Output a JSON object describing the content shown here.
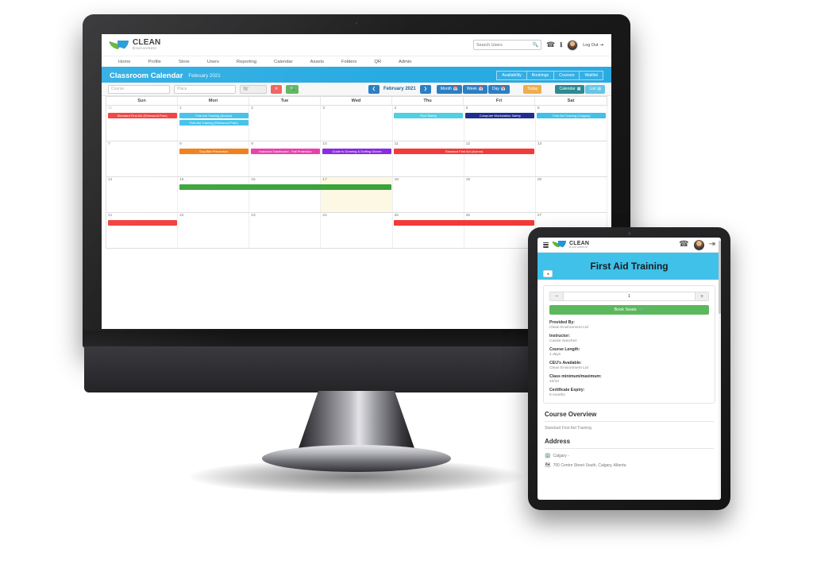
{
  "desktop": {
    "brand": {
      "name": "CLEAN",
      "tagline": "Environment"
    },
    "search": {
      "placeholder": "Search Users"
    },
    "topbar": {
      "phone_icon": "phone-icon",
      "info_icon": "info-icon",
      "logout_label": "Log Out"
    },
    "nav": [
      "Home",
      "Profile",
      "Store",
      "Users",
      "Reporting",
      "Calendar",
      "Assets",
      "Folders",
      "QR",
      "Admin"
    ],
    "page": {
      "title": "Classroom Calendar",
      "subtitle": "February 2021",
      "tabs": [
        "Availability",
        "Bookings",
        "Courses",
        "Waitlist"
      ]
    },
    "toolbar": {
      "course_placeholder": "Course",
      "place_placeholder": "Place",
      "days_label": "Days",
      "days_value": "70",
      "clear_icon": "clear-icon",
      "search_icon": "search-icon",
      "prev_label": "❮",
      "month_label": "February 2021",
      "next_label": "❯",
      "view_month": "Month",
      "view_week": "Week",
      "view_day": "Day",
      "today": "Today",
      "calendar_view": "Calendar",
      "list_view": "List"
    },
    "calendar": {
      "weekdays": [
        "Sun",
        "Mon",
        "Tue",
        "Wed",
        "Thu",
        "Fri",
        "Sat"
      ],
      "today_index": 17,
      "weeks": [
        {
          "days": [
            {
              "num": "31",
              "muted": true
            },
            {
              "num": "1"
            },
            {
              "num": "2"
            },
            {
              "num": "3"
            },
            {
              "num": "4"
            },
            {
              "num": "5"
            },
            {
              "num": "6"
            }
          ],
          "events": [
            {
              "title": "Standard First Aid (Sherwood Park)",
              "start": 0,
              "span": 1,
              "row": 0,
              "color": "#f23b38"
            },
            {
              "title": "First Aid Training (Aurora)",
              "start": 1,
              "span": 1,
              "row": 0,
              "color": "#3fc1ea"
            },
            {
              "title": "First Aid Training (Sherwood Park)",
              "start": 1,
              "span": 1,
              "row": 1,
              "color": "#3fc1ea"
            },
            {
              "title": "Pool Safety",
              "start": 4,
              "span": 1,
              "row": 0,
              "color": "#4fd0e3"
            },
            {
              "title": "Computer Workstation Safety",
              "start": 5,
              "span": 1,
              "row": 0,
              "color": "#1f2f8f"
            },
            {
              "title": "First Aid Training (Calgary)",
              "start": 6,
              "span": 1,
              "row": 0,
              "color": "#3fc1ea"
            }
          ]
        },
        {
          "days": [
            {
              "num": "7"
            },
            {
              "num": "8"
            },
            {
              "num": "9"
            },
            {
              "num": "10"
            },
            {
              "num": "11"
            },
            {
              "num": "12"
            },
            {
              "num": "13"
            }
          ],
          "events": [
            {
              "title": "Dog Bite Prevention",
              "start": 1,
              "span": 1,
              "row": 0,
              "color": "#f07c18"
            },
            {
              "title": "Instructor Dashboard - Fall Protection",
              "start": 2,
              "span": 1,
              "row": 0,
              "color": "#e83fa8"
            },
            {
              "title": "Guide to Donning & Doffing Gloves",
              "start": 3,
              "span": 1,
              "row": 0,
              "color": "#8a2be2"
            },
            {
              "title": "Standard First Aid (Aurora)",
              "start": 4,
              "span": 2,
              "row": 0,
              "color": "#f23b38"
            }
          ]
        },
        {
          "days": [
            {
              "num": "14"
            },
            {
              "num": "15"
            },
            {
              "num": "16"
            },
            {
              "num": "17",
              "today": true
            },
            {
              "num": "18"
            },
            {
              "num": "19"
            },
            {
              "num": "20"
            }
          ],
          "events": [
            {
              "title": "",
              "start": 1,
              "span": 3,
              "row": 0,
              "color": "#3aa33a"
            }
          ]
        },
        {
          "days": [
            {
              "num": "21"
            },
            {
              "num": "22"
            },
            {
              "num": "23"
            },
            {
              "num": "24"
            },
            {
              "num": "25"
            },
            {
              "num": "26"
            },
            {
              "num": "27"
            }
          ],
          "events": [
            {
              "title": "",
              "start": 0,
              "span": 1,
              "row": 0,
              "color": "#f23b38"
            },
            {
              "title": "",
              "start": 4,
              "span": 2,
              "row": 0,
              "color": "#f23b38"
            }
          ]
        }
      ]
    }
  },
  "tablet": {
    "brand": {
      "name": "CLEAN",
      "tagline": "Environment"
    },
    "header": {
      "menu_icon": "hamburger-icon",
      "phone_icon": "phone-icon",
      "logout_icon": "logout-icon"
    },
    "hero": {
      "title": "First Aid Training",
      "back_label": "◂"
    },
    "booking": {
      "minus": "−",
      "plus": "+",
      "quantity": "1",
      "book_label": "Book Seats",
      "cart_icon": "cart-icon"
    },
    "details": [
      {
        "key": "Provided By:",
        "value": "Clean Environment Ltd"
      },
      {
        "key": "Instructor:",
        "value": "Cassie Sanchez"
      },
      {
        "key": "Course Length:",
        "value": "1 days"
      },
      {
        "key": "CEU's Available:",
        "value": "Clean Environment Ltd"
      },
      {
        "key": "Class minimum/maximum:",
        "value": "10/10"
      },
      {
        "key": "Certificate Expiry:",
        "value": "6 months"
      }
    ],
    "overview": {
      "heading": "Course Overview",
      "text": "Standard First Aid Training"
    },
    "address": {
      "heading": "Address",
      "city_icon": "building-icon",
      "city": "Calgary -",
      "street_icon": "map-icon",
      "street": "700 Centre Street South, Calgary, Alberta"
    }
  }
}
